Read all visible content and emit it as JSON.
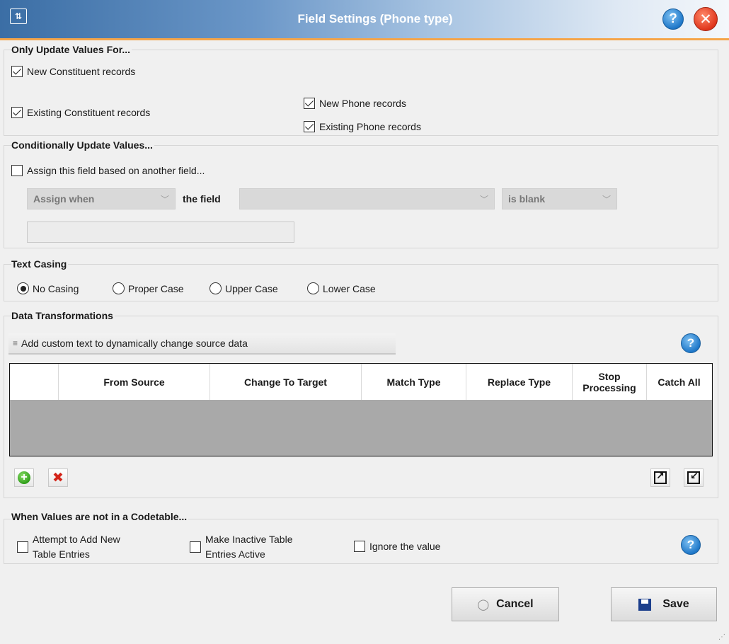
{
  "window": {
    "title": "Field Settings (Phone type)",
    "help_glyph": "?",
    "close_glyph": "✕"
  },
  "only_update": {
    "title": "Only Update Values For...",
    "new_constituent": {
      "label": "New Constituent records",
      "checked": true
    },
    "existing_constituent": {
      "label": "Existing Constituent records",
      "checked": true
    },
    "new_phone": {
      "label": "New Phone records",
      "checked": true
    },
    "existing_phone": {
      "label": "Existing Phone records",
      "checked": true
    }
  },
  "conditional": {
    "title": "Conditionally Update Values...",
    "assign_checkbox": {
      "label": "Assign this field based on another field...",
      "checked": false
    },
    "assign_when": "Assign when",
    "the_field_label": "the field",
    "field_value": "",
    "condition": "is blank",
    "value_text": ""
  },
  "text_casing": {
    "title": "Text Casing",
    "options": [
      "No Casing",
      "Proper Case",
      "Upper Case",
      "Lower Case"
    ],
    "selected": "No Casing"
  },
  "transformations": {
    "title": "Data Transformations",
    "add_custom_label": "Add custom text to dynamically change source data",
    "columns": [
      "",
      "From Source",
      "Change To Target",
      "Match Type",
      "Replace Type",
      "Stop Processing",
      "Catch All"
    ],
    "rows": []
  },
  "codetable": {
    "title": "When Values are not in a Codetable...",
    "attempt_add": {
      "label_line1": "Attempt to Add New",
      "label_line2": "Table Entries",
      "checked": false
    },
    "make_active": {
      "label_line1": "Make Inactive Table",
      "label_line2": "Entries Active",
      "checked": false
    },
    "ignore": {
      "label": "Ignore the value",
      "checked": false
    }
  },
  "buttons": {
    "cancel": "Cancel",
    "save": "Save"
  },
  "icons": {
    "app": "settings-sliders-icon",
    "help": "help-icon",
    "close": "close-icon",
    "add": "plus-circle-icon",
    "delete": "red-x-icon",
    "export": "export-icon",
    "import": "import-icon",
    "save": "floppy-disk-icon",
    "cancel": "cancel-icon"
  },
  "colors": {
    "title_bar_start": "#3b6ea5",
    "title_accent": "#f5a54a",
    "grid_body": "#a9a9a9",
    "help_blue": "#1f78c9",
    "close_red": "#e0361d"
  }
}
